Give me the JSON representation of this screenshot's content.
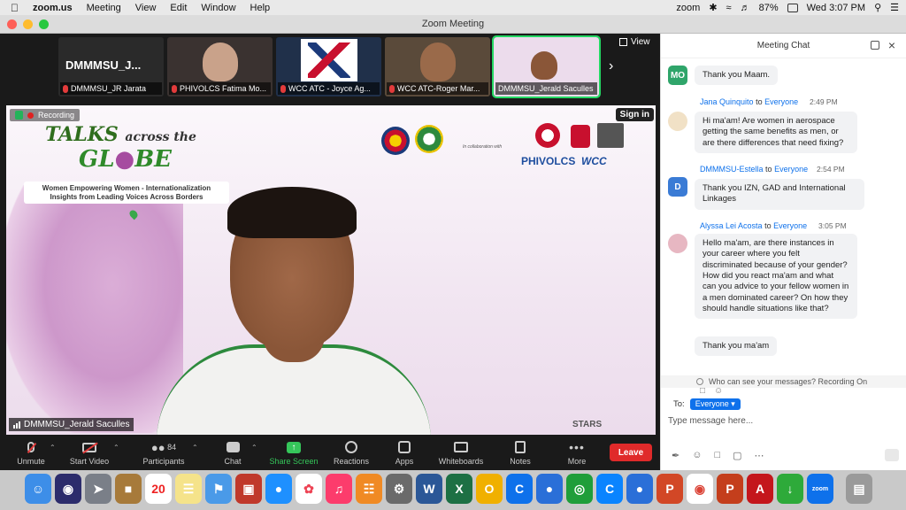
{
  "menubar": {
    "app_name": "zoom.us",
    "items": [
      "Meeting",
      "View",
      "Edit",
      "Window",
      "Help"
    ],
    "status_app": "zoom",
    "battery": "87%",
    "clock": "Wed 3:07 PM"
  },
  "window": {
    "title": "Zoom Meeting"
  },
  "thumbnails": [
    {
      "big_name": "DMMMSU_J...",
      "caption": "DMMMSU_JR Jarata"
    },
    {
      "caption": "PHIVOLCS Fatima Mo..."
    },
    {
      "caption": "WCC ATC - Joyce Ag..."
    },
    {
      "caption": "WCC ATC-Roger Mar..."
    },
    {
      "caption": "DMMMSU_Jerald Saculles"
    }
  ],
  "view_label": "View",
  "main_video": {
    "recording_label": "Recording",
    "sign_in_label": "Sign in",
    "event_title_1": "TALKS",
    "event_title_2": "across the",
    "event_title_3": "GL",
    "event_title_4": "BE",
    "event_subtitle": "Women Empowering Women - Internationalization Insights from Leading Voices Across Borders",
    "collab_text": "In collaboration with",
    "phivolcs_logo": "PHIVOLCS",
    "wcc_logo": "WCC",
    "stars_logo": "STARS",
    "speaker_name": "DMMMSU_Jerald Saculles"
  },
  "toolbar": {
    "unmute": "Unmute",
    "start_video": "Start Video",
    "participants": "Participants",
    "participants_count": "84",
    "chat": "Chat",
    "share_screen": "Share Screen",
    "reactions": "Reactions",
    "apps": "Apps",
    "whiteboards": "Whiteboards",
    "notes": "Notes",
    "more": "More",
    "leave": "Leave"
  },
  "chat": {
    "title": "Meeting Chat",
    "messages": [
      {
        "avatar_text": "MO",
        "text": "Thank you Maam."
      },
      {
        "sender": "Jana Quinquito",
        "to": "to",
        "recipient": "Everyone",
        "time": "2:49 PM",
        "text": "Hi ma'am! Are women in aerospace getting the same benefits as men, or are there differences that need fixing?"
      },
      {
        "avatar_text": "D",
        "sender": "DMMMSU-Estella",
        "to": "to",
        "recipient": "Everyone",
        "time": "2:54 PM",
        "text": "Thank you IZN, GAD and International Linkages"
      },
      {
        "sender": "Alyssa Lei Acosta",
        "to": "to",
        "recipient": "Everyone",
        "time": "3:05 PM",
        "text": "Hello ma'am, are there instances in your career where you felt discriminated because of your gender? How did you react ma'am and what can you advice to your fellow women in a men dominated career? On how they should handle situations like that?",
        "text2": "Thank you ma'am"
      }
    ],
    "who_can_see": "Who can see your messages? Recording On",
    "to_label": "To:",
    "to_value": "Everyone",
    "input_placeholder": "Type message here..."
  },
  "colors": {
    "zoom_blue": "#0e71eb",
    "leave_red": "#e02a2a",
    "share_green": "#35c65a"
  }
}
